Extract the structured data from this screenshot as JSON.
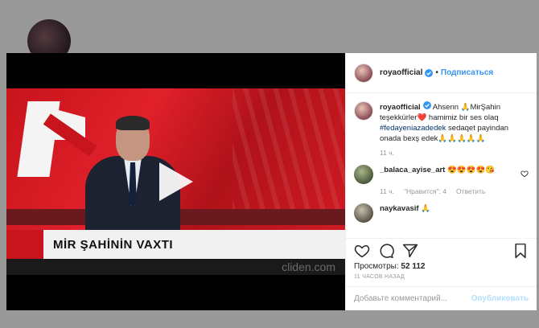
{
  "colors": {
    "accent": "#3897f0",
    "hashtag": "#003569",
    "muted": "#999999",
    "publish_disabled": "#b2dffc"
  },
  "header": {
    "username": "royaofficial",
    "separator": "•",
    "follow_label": "Подписаться"
  },
  "video": {
    "banner_text": "MİR ŞAHİNİN VAXTI",
    "watermark": "cliden.com"
  },
  "caption": {
    "username": "royaofficial",
    "text_part1": " Ahsenn 🙏MirŞahin teşekkürler❤️ hamimiz bir ses olaq ",
    "hashtag": "#fedayeniazadedek",
    "text_part2": " sedaqet payindan onada bexş edek🙏🙏🙏🙏🙏",
    "time": "11 ч."
  },
  "comments": [
    {
      "username": "_balaca_ayise_art",
      "text": " 😍😍😍😍😘",
      "time": "11 ч.",
      "likes": "\"Нравится\": 4",
      "reply": "Ответить"
    },
    {
      "username": "naykavasif",
      "text": " 🙏"
    }
  ],
  "stats": {
    "views_label": "Просмотры:",
    "views_count": "52 112",
    "posted": "11 ЧАСОВ НАЗАД"
  },
  "add_comment": {
    "placeholder": "Добавьте комментарий...",
    "publish_label": "Опубликовать"
  },
  "icons": {
    "heart": "heart-icon",
    "comment": "comment-icon",
    "share": "share-icon",
    "save": "bookmark-icon",
    "play": "play-icon",
    "verified": "verified-badge-icon",
    "next": "chevron-right-icon"
  }
}
